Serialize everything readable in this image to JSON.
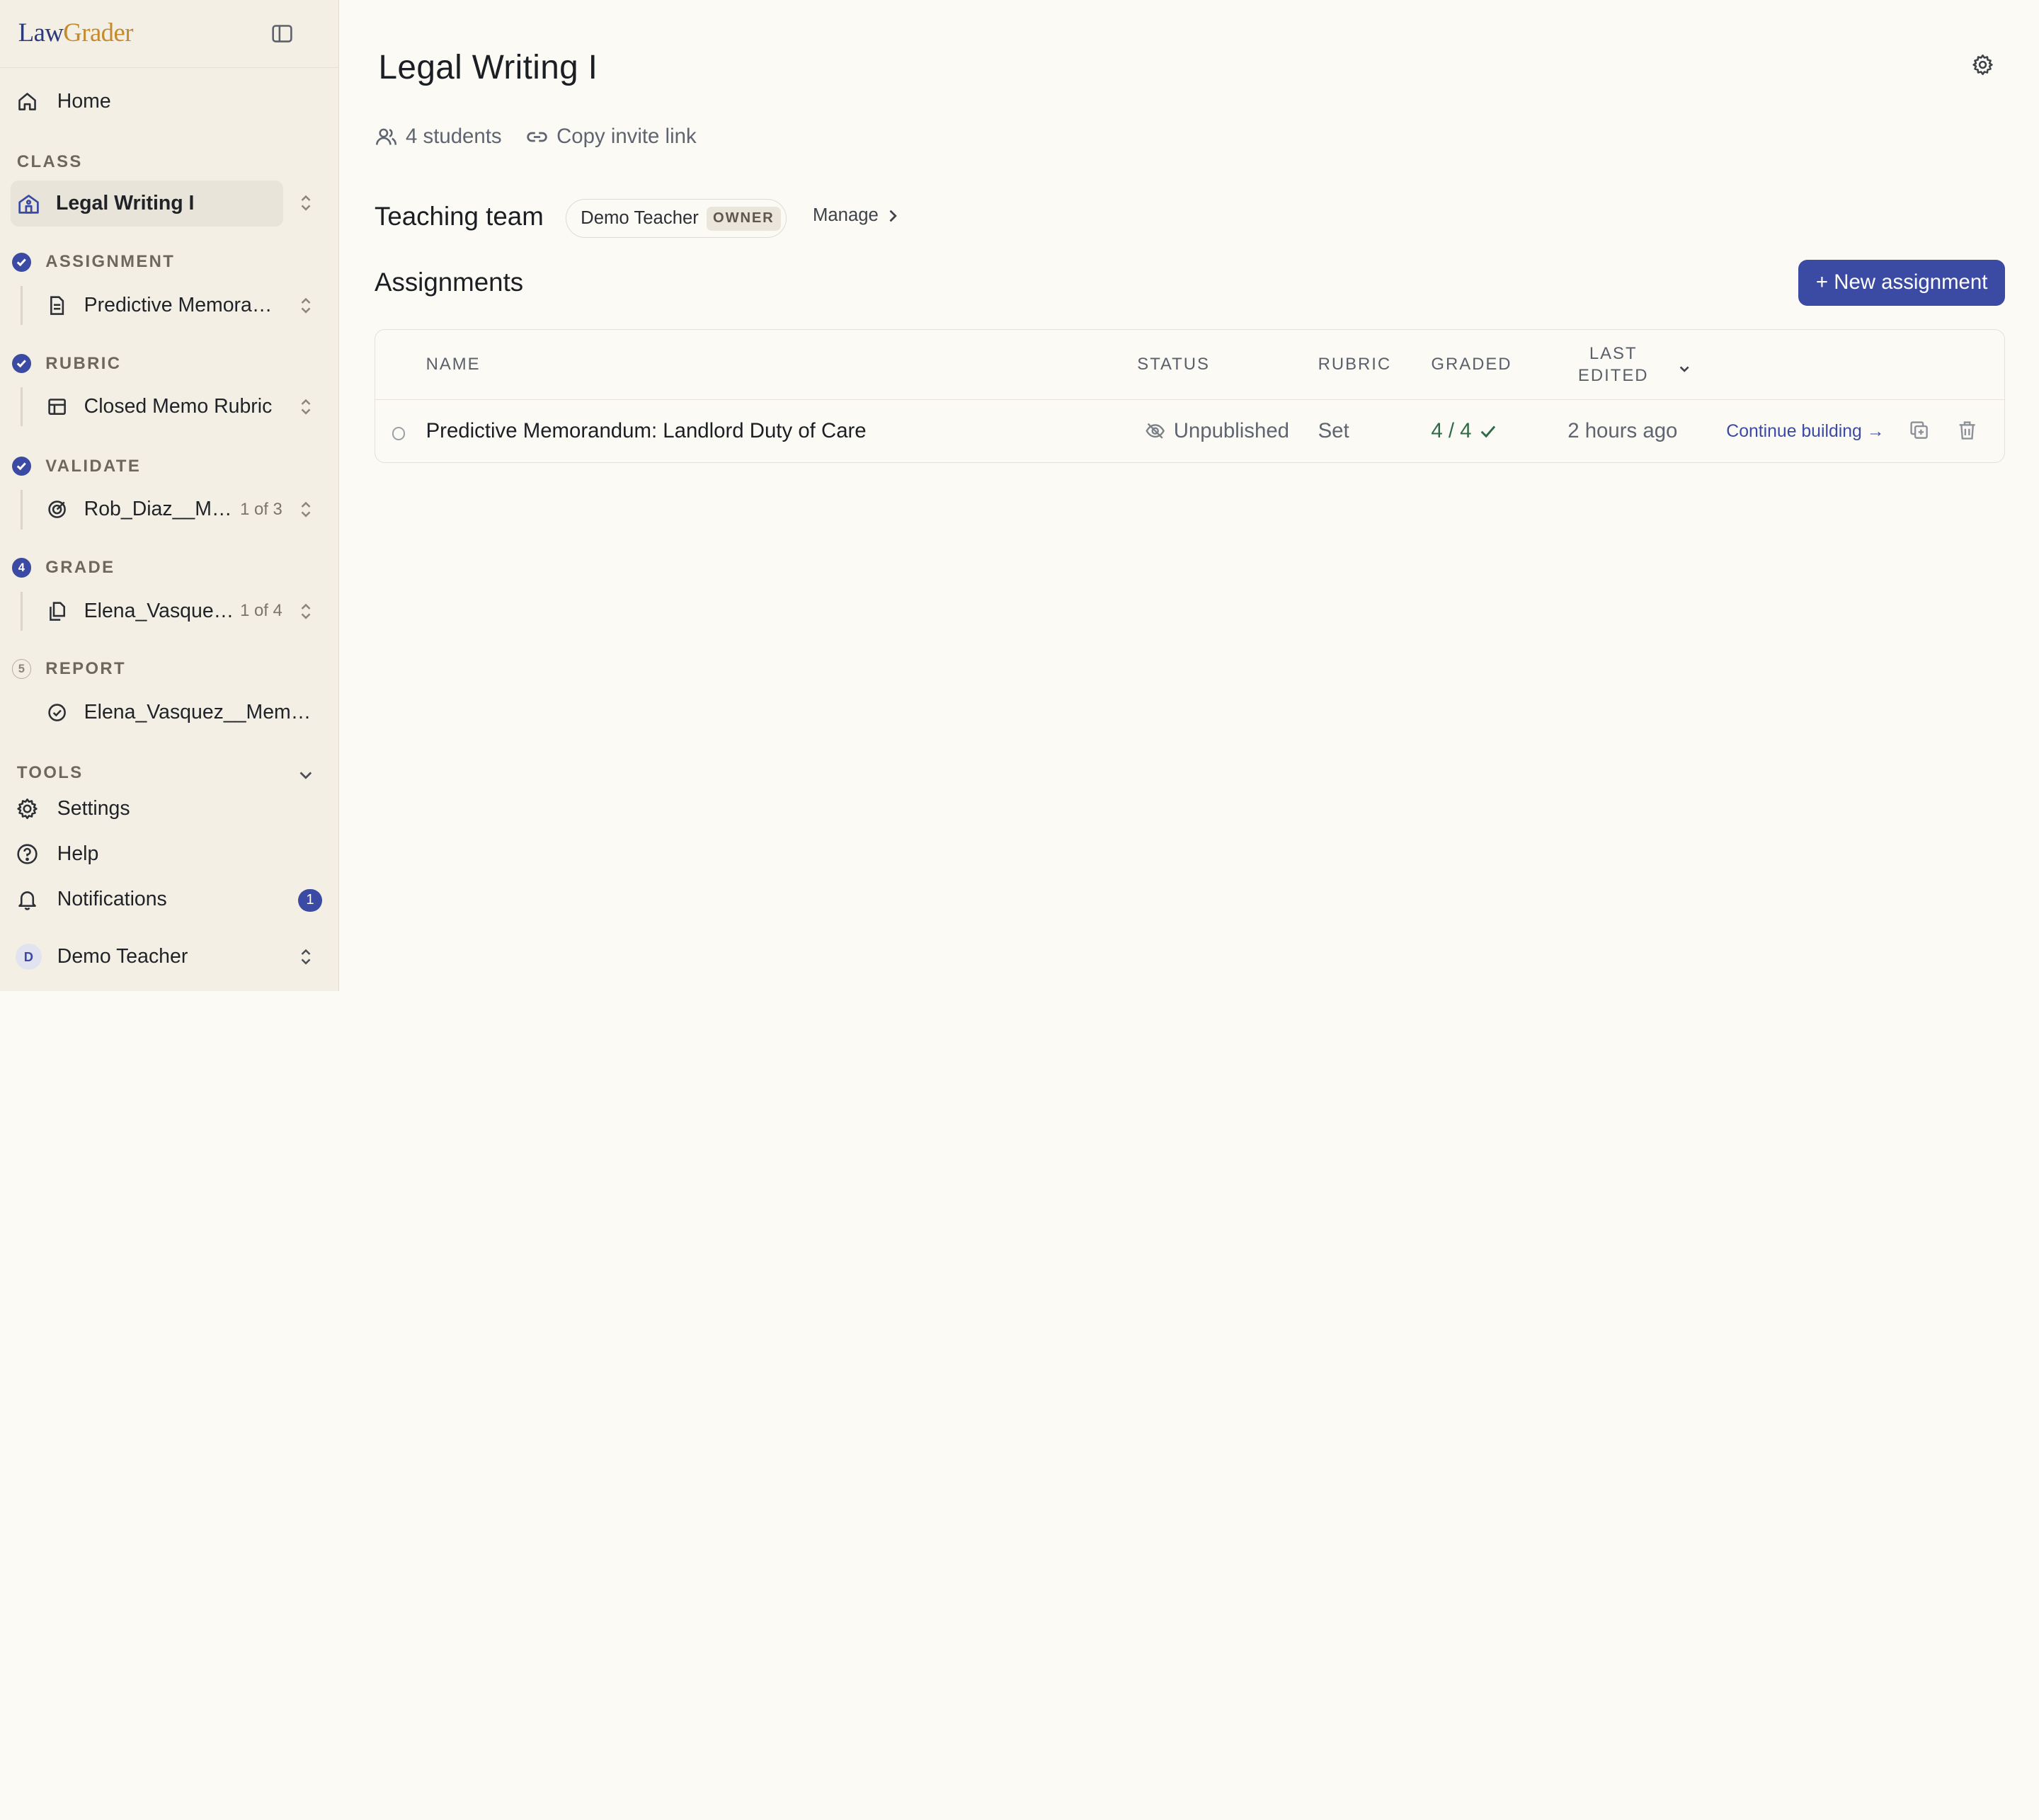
{
  "brand": {
    "part1": "Law",
    "part2": "Grader"
  },
  "sidebar": {
    "home_label": "Home",
    "class_section": "CLASS",
    "class_name": "Legal Writing I",
    "steps": [
      {
        "label": "ASSIGNMENT",
        "item": "Predictive Memorandum: Landlord Duty of Care",
        "count": ""
      },
      {
        "label": "RUBRIC",
        "item": "Closed Memo Rubric",
        "count": ""
      },
      {
        "label": "VALIDATE",
        "item": "Rob_Diaz__Memo",
        "count": "1 of 3"
      },
      {
        "label": "GRADE",
        "number": "4",
        "item": "Elena_Vasquez__Memo",
        "count": "1 of 4"
      },
      {
        "label": "REPORT",
        "number": "5",
        "item": "Elena_Vasquez__Memo.docx",
        "count": ""
      }
    ],
    "tools_section": "TOOLS",
    "settings_label": "Settings",
    "help_label": "Help",
    "notifications_label": "Notifications",
    "notifications_count": "1",
    "user_initial": "D",
    "user_name": "Demo Teacher"
  },
  "main": {
    "title": "Legal Writing I",
    "students": "4 students",
    "invite": "Copy invite link",
    "team_title": "Teaching team",
    "team_member": "Demo Teacher",
    "owner_tag": "OWNER",
    "manage_label": "Manage",
    "assignments_title": "Assignments",
    "new_assignment": "+ New assignment"
  },
  "table": {
    "headers": {
      "name": "NAME",
      "status": "STATUS",
      "rubric": "RUBRIC",
      "graded": "GRADED",
      "last_edited_1": "LAST",
      "last_edited_2": "EDITED"
    },
    "rows": [
      {
        "name": "Predictive Memorandum: Landlord Duty of Care",
        "status": "Unpublished",
        "rubric": "Set",
        "graded": "4 / 4",
        "last_edited": "2 hours ago",
        "action": "Continue building →"
      }
    ]
  },
  "colors": {
    "accent": "#3b4aa3",
    "success": "#2f6b47",
    "sidebar_bg": "#f4efe5",
    "page_bg": "#fcfaf5"
  }
}
